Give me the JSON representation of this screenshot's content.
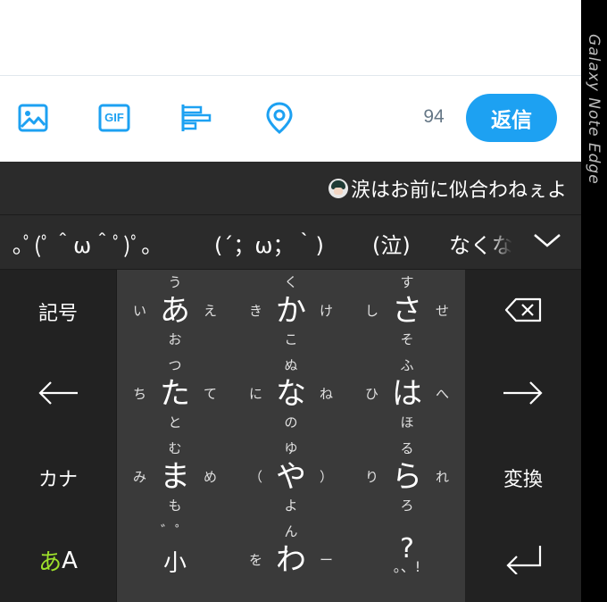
{
  "compose": {
    "text": ""
  },
  "toolbar": {
    "icons": [
      "image-icon",
      "gif-icon",
      "poll-icon",
      "location-icon"
    ],
    "gif_label": "GIF",
    "char_count": "94",
    "reply_label": "返信",
    "accent": "#1da1f2"
  },
  "edge_panel": {
    "label": "Galaxy Note Edge"
  },
  "keyboard": {
    "prediction": "涙はお前に似合わねぇよ",
    "prediction_icon": "avatar",
    "candidates": [
      "｡ﾟ(ﾟ＾ω＾ﾟ)ﾟ｡",
      "(´；ω；｀)",
      "(泣)",
      "なくな"
    ],
    "expand_icon": "chevron-down-icon",
    "side_keys": {
      "symbols": "記号",
      "kana": "カナ",
      "convert": "変換",
      "mode_a": "あ",
      "mode_b": "A"
    },
    "side_icons": [
      "backspace-icon",
      "arrow-left-icon",
      "arrow-right-icon",
      "enter-icon"
    ],
    "flick_keys": [
      {
        "center": "あ",
        "up": "う",
        "down": "お",
        "left": "い",
        "right": "え"
      },
      {
        "center": "か",
        "up": "く",
        "down": "こ",
        "left": "き",
        "right": "け"
      },
      {
        "center": "さ",
        "up": "す",
        "down": "そ",
        "left": "し",
        "right": "せ"
      },
      {
        "center": "た",
        "up": "つ",
        "down": "と",
        "left": "ち",
        "right": "て"
      },
      {
        "center": "な",
        "up": "ぬ",
        "down": "の",
        "left": "に",
        "right": "ね"
      },
      {
        "center": "は",
        "up": "ふ",
        "down": "ほ",
        "left": "ひ",
        "right": "へ"
      },
      {
        "center": "ま",
        "up": "む",
        "down": "も",
        "left": "み",
        "right": "め"
      },
      {
        "center": "や",
        "up": "ゆ",
        "down": "よ",
        "left": "（",
        "right": "）"
      },
      {
        "center": "ら",
        "up": "る",
        "down": "ろ",
        "left": "り",
        "right": "れ"
      },
      {
        "center": "小",
        "up": "゛゜",
        "down": "",
        "left": "",
        "right": ""
      },
      {
        "center": "わ",
        "up": "ん",
        "down": "",
        "left": "を",
        "right": "ー"
      },
      {
        "center": "?",
        "up": "",
        "down": "。、!",
        "left": "",
        "right": ""
      }
    ],
    "colors": {
      "key_main": "#3a3a3a",
      "key_side": "#222222",
      "mode_accent": "#9de02b"
    }
  }
}
